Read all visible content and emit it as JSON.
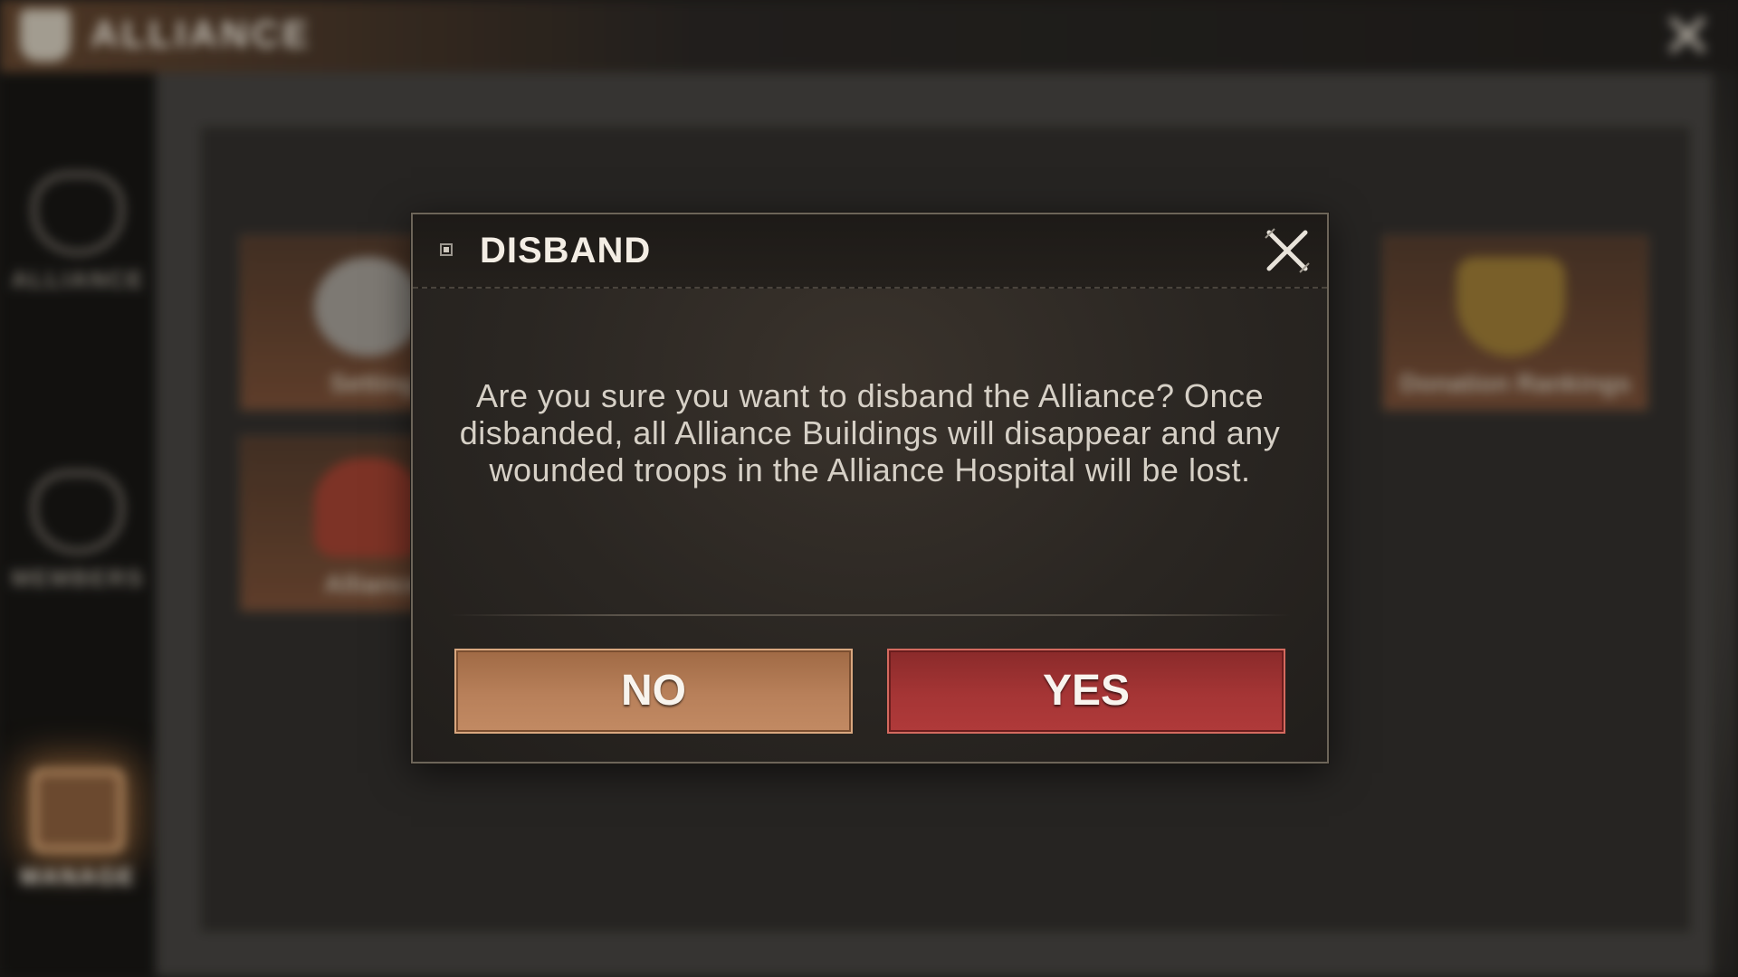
{
  "background": {
    "window_title": "ALLIANCE",
    "sidebar": [
      {
        "label": "ALLIANCE",
        "icon": "alliance-shield-icon"
      },
      {
        "label": "MEMBERS",
        "icon": "members-portrait-icon"
      },
      {
        "label": "MANAGE",
        "icon": "manage-clipboard-icon",
        "active": true
      }
    ],
    "cards": [
      {
        "label": "Setting",
        "icon": "gear-icon"
      },
      {
        "label": "Alliance",
        "icon": "hero-portrait-icon"
      },
      {
        "label": "Donation Rankings",
        "icon": "trophy-icon"
      }
    ]
  },
  "dialog": {
    "title": "DISBAND",
    "message": "Are you sure you want to disband the Alliance? Once disbanded, all Alliance Buildings will disappear and any wounded troops in the Alliance Hospital will be lost.",
    "no_label": "NO",
    "yes_label": "YES",
    "close_icon": "close-icon"
  },
  "colors": {
    "no_button": "#b8805a",
    "yes_button": "#a53535",
    "dialog_bg": "#2a2622"
  }
}
